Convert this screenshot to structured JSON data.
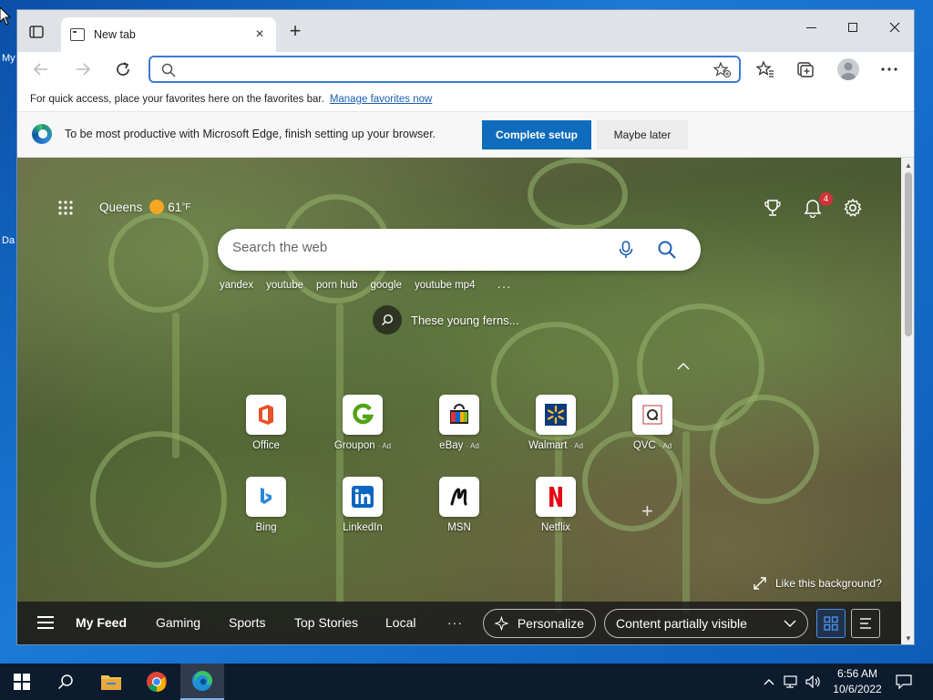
{
  "desktop": {
    "labels": [
      "My",
      "Da"
    ]
  },
  "browser": {
    "tab": {
      "title": "New tab",
      "close": "×"
    },
    "new_tab": "+",
    "address": {
      "placeholder": "",
      "value": ""
    },
    "favorites_bar": {
      "text": "For quick access, place your favorites here on the favorites bar.",
      "link": "Manage favorites now"
    },
    "setup_bar": {
      "text": "To be most productive with Microsoft Edge, finish setting up your browser.",
      "primary": "Complete setup",
      "secondary": "Maybe later"
    }
  },
  "ntp": {
    "weather": {
      "location": "Queens",
      "temp": "61",
      "unit": "°F"
    },
    "notifications_count": "4",
    "search": {
      "placeholder": "Search the web"
    },
    "quick_searches": [
      "yandex",
      "youtube",
      "porn hub",
      "google",
      "youtube mp4"
    ],
    "quick_more": "···",
    "image_caption": "These young ferns...",
    "tiles": [
      {
        "label": "Office",
        "ad": ""
      },
      {
        "label": "Groupon",
        "ad": "Ad"
      },
      {
        "label": "eBay",
        "ad": "Ad"
      },
      {
        "label": "Walmart",
        "ad": "Ad"
      },
      {
        "label": "QVC",
        "ad": "Ad"
      },
      {
        "label": "Bing",
        "ad": ""
      },
      {
        "label": "LinkedIn",
        "ad": ""
      },
      {
        "label": "MSN",
        "ad": ""
      },
      {
        "label": "Netflix",
        "ad": ""
      }
    ],
    "like_background": "Like this background?",
    "feed": {
      "items": [
        "My Feed",
        "Gaming",
        "Sports",
        "Top Stories",
        "Local"
      ],
      "more": "···",
      "personalize": "Personalize",
      "visibility": "Content partially visible"
    }
  },
  "taskbar": {
    "time": "6:56 AM",
    "date": "10/6/2022"
  },
  "colors": {
    "accent": "#0f6cbd",
    "address_border": "#3a7bd5",
    "badge": "#d13438",
    "taskbar": "#0c1b2e"
  }
}
